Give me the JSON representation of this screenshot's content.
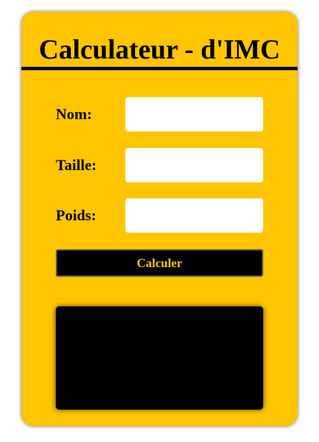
{
  "header": {
    "title": "Calculateur - d'IMC"
  },
  "form": {
    "name_label": "Nom:",
    "name_value": "",
    "height_label": "Taille:",
    "height_value": "",
    "weight_label": "Poids:",
    "weight_value": "",
    "submit_label": "Calculer"
  },
  "result": {
    "text": ""
  },
  "colors": {
    "card_background": "#ffc500",
    "button_background": "#000000",
    "button_text": "#ffc500",
    "result_background": "#000000"
  }
}
